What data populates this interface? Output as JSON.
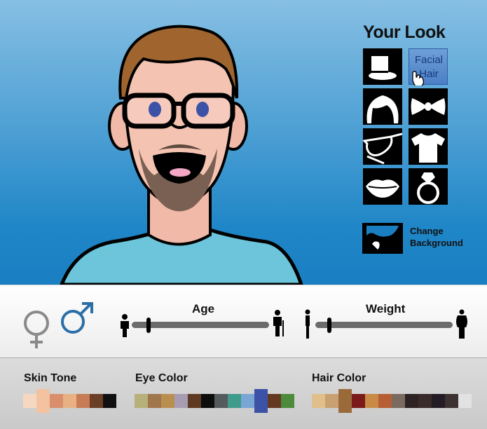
{
  "panel": {
    "title": "Your Look"
  },
  "categories": [
    {
      "id": "hat",
      "icon": "top-hat-icon"
    },
    {
      "id": "facial-hair",
      "label_line1": "Facial",
      "label_line2": "Hair",
      "icon": "pointer-hand-icon",
      "selected": true
    },
    {
      "id": "hair",
      "icon": "hair-icon"
    },
    {
      "id": "bow-tie",
      "icon": "bow-tie-icon"
    },
    {
      "id": "glasses",
      "icon": "glasses-icon"
    },
    {
      "id": "shirt",
      "icon": "t-shirt-icon"
    },
    {
      "id": "lips",
      "icon": "lips-icon"
    },
    {
      "id": "ring",
      "icon": "ring-icon"
    }
  ],
  "background": {
    "line1": "Change",
    "line2": "Background",
    "icon": "landscape-icon"
  },
  "gender": {
    "female_icon": "female-symbol-icon",
    "male_icon": "male-symbol-icon",
    "selected": "male"
  },
  "sliders": {
    "age": {
      "label": "Age",
      "value": 0.12,
      "min_icon": "child-icon",
      "max_icon": "elder-icon"
    },
    "weight": {
      "label": "Weight",
      "value": 0.1,
      "min_icon": "thin-person-icon",
      "max_icon": "heavy-person-icon"
    }
  },
  "palettes": {
    "skin": {
      "label": "Skin Tone",
      "selected": 1,
      "colors": [
        "#f6d8c2",
        "#f2c2a1",
        "#d98f6c",
        "#e9b183",
        "#c77c55",
        "#6b3e26",
        "#101010"
      ]
    },
    "eye": {
      "label": "Eye Color",
      "selected": 9,
      "colors": [
        "#b7b07a",
        "#a0774c",
        "#b98f50",
        "#a89cb2",
        "#5e3a22",
        "#0d0d0d",
        "#555a5c",
        "#3f9b8c",
        "#7aa6d6",
        "#3b52a6",
        "#64391f",
        "#4d8a3a"
      ]
    },
    "hair": {
      "label": "Hair Color",
      "selected": 2,
      "colors": [
        "#e0bf8a",
        "#c9a072",
        "#9b6a3a",
        "#7a1a1a",
        "#c88a45",
        "#b75e34",
        "#7b6a60",
        "#2c2322",
        "#3a2a2a",
        "#231c24",
        "#3c3232",
        "#e2e2e2"
      ]
    }
  }
}
